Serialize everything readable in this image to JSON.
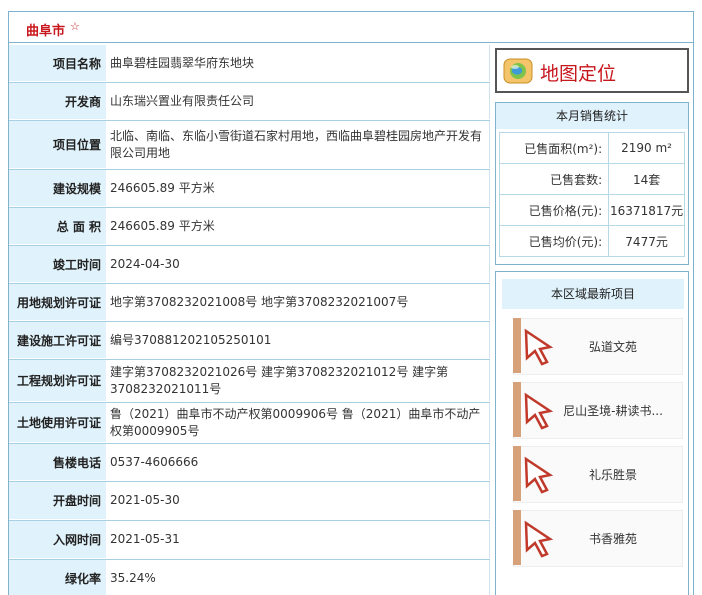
{
  "header": {
    "city": "曲阜市",
    "star": "☆"
  },
  "info_rows": [
    {
      "label": "项目名称",
      "value": "曲阜碧桂园翡翠华府东地块"
    },
    {
      "label": "开发商",
      "value": "山东瑞兴置业有限责任公司"
    },
    {
      "label": "项目位置",
      "value": "北临、南临、东临小雪街道石家村用地，西临曲阜碧桂园房地产开发有限公司用地"
    },
    {
      "label": "建设规模",
      "value": "246605.89 平方米"
    },
    {
      "label": "总 面 积",
      "value": "246605.89 平方米"
    },
    {
      "label": "竣工时间",
      "value": "2024-04-30"
    },
    {
      "label": "用地规划许可证",
      "value": "地字第3708232021008号 地字第3708232021007号"
    },
    {
      "label": "建设施工许可证",
      "value": "编号370881202105250101"
    },
    {
      "label": "工程规划许可证",
      "value": "建字第3708232021026号 建字第3708232021012号 建字第3708232021011号"
    },
    {
      "label": "土地使用许可证",
      "value": "鲁（2021）曲阜市不动产权第0009906号 鲁（2021）曲阜市不动产权第0009905号"
    },
    {
      "label": "售楼电话",
      "value": "0537-4606666"
    },
    {
      "label": "开盘时间",
      "value": "2021-05-30"
    },
    {
      "label": "入网时间",
      "value": "2021-05-31"
    },
    {
      "label": "绿化率",
      "value": "35.24%"
    }
  ],
  "map_button": {
    "label": "地图定位",
    "icon": "globe-icon"
  },
  "sales": {
    "title": "本月销售统计",
    "rows": [
      {
        "key": "已售面积(m²):",
        "value": "2190 m²"
      },
      {
        "key": "已售套数:",
        "value": "14套"
      },
      {
        "key": "已售价格(元):",
        "value": "16371817元"
      },
      {
        "key": "已售均价(元):",
        "value": "7477元"
      }
    ]
  },
  "latest": {
    "title": "本区域最新项目",
    "items": [
      {
        "name": "弘道文苑"
      },
      {
        "name": "尼山圣境-耕读书..."
      },
      {
        "name": "礼乐胜景"
      },
      {
        "name": "书香雅苑"
      }
    ]
  },
  "colors": {
    "accent_red": "#c8161d",
    "label_bg": "#e0f2fb",
    "border": "#7fb2cd"
  }
}
